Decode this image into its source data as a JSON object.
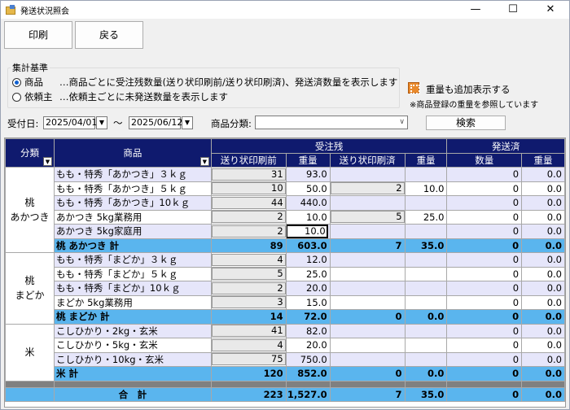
{
  "window": {
    "title": "発送状況照会",
    "minimize": "—",
    "maximize": "☐",
    "close": "✕"
  },
  "toolbar": {
    "print_label": "印刷",
    "back_label": "戻る"
  },
  "criteria": {
    "group_label": "集計基準",
    "opt_product": "商品",
    "opt_product_desc": "…商品ごとに受注残数量(送り状印刷前/送り状印刷済)、発送済数量を表示します",
    "opt_client": "依頼主",
    "opt_client_desc": "…依頼主ごとに未発送数量を表示します",
    "selected": "商品"
  },
  "weight": {
    "label": "重量も追加表示する",
    "note": "※商品登録の重量を参照しています"
  },
  "filter": {
    "date_label": "受付日:",
    "date_from": "2025/04/01",
    "tilde": "〜",
    "date_to": "2025/06/12",
    "category_label": "商品分類:",
    "category_value": "",
    "search_label": "検索"
  },
  "grid": {
    "headers": {
      "category": "分類",
      "product": "商品",
      "backlog": "受注残",
      "shipped": "発送済",
      "before_print": "送り状印刷前",
      "weight": "重量",
      "after_print": "送り状印刷済",
      "qty": "数量"
    },
    "groups": [
      {
        "category": "桃\nあかつき",
        "rows": [
          {
            "name": "もも・特秀「あかつき」３ｋｇ",
            "bp": "31",
            "bpw": "93.0",
            "ap": "",
            "apw": "",
            "sq": "0",
            "sw": "0.0"
          },
          {
            "name": "もも・特秀「あかつき」５ｋｇ",
            "bp": "10",
            "bpw": "50.0",
            "ap": "2",
            "apw": "10.0",
            "sq": "0",
            "sw": "0.0"
          },
          {
            "name": "もも・特秀「あかつき」10ｋｇ",
            "bp": "44",
            "bpw": "440.0",
            "ap": "",
            "apw": "",
            "sq": "0",
            "sw": "0.0"
          },
          {
            "name": "あかつき 5kg業務用",
            "bp": "2",
            "bpw": "10.0",
            "ap": "5",
            "apw": "25.0",
            "sq": "0",
            "sw": "0.0"
          },
          {
            "name": "あかつき 5kg家庭用",
            "bp": "2",
            "bpw": "10.0",
            "ap": "",
            "apw": "",
            "sq": "0",
            "sw": "0.0"
          }
        ],
        "subtotal": {
          "name": "桃 あかつき 計",
          "bp": "89",
          "bpw": "603.0",
          "ap": "7",
          "apw": "35.0",
          "sq": "0",
          "sw": "0.0"
        }
      },
      {
        "category": "桃\nまどか",
        "rows": [
          {
            "name": "もも・特秀「まどか」３ｋｇ",
            "bp": "4",
            "bpw": "12.0",
            "ap": "",
            "apw": "",
            "sq": "0",
            "sw": "0.0"
          },
          {
            "name": "もも・特秀「まどか」５ｋｇ",
            "bp": "5",
            "bpw": "25.0",
            "ap": "",
            "apw": "",
            "sq": "0",
            "sw": "0.0"
          },
          {
            "name": "もも・特秀「まどか」10ｋｇ",
            "bp": "2",
            "bpw": "20.0",
            "ap": "",
            "apw": "",
            "sq": "0",
            "sw": "0.0"
          },
          {
            "name": "まどか 5kg業務用",
            "bp": "3",
            "bpw": "15.0",
            "ap": "",
            "apw": "",
            "sq": "0",
            "sw": "0.0"
          }
        ],
        "subtotal": {
          "name": "桃 まどか 計",
          "bp": "14",
          "bpw": "72.0",
          "ap": "0",
          "apw": "0.0",
          "sq": "0",
          "sw": "0.0"
        }
      },
      {
        "category": "米",
        "rows": [
          {
            "name": "こしひかり・2kg・玄米",
            "bp": "41",
            "bpw": "82.0",
            "ap": "",
            "apw": "",
            "sq": "0",
            "sw": "0.0"
          },
          {
            "name": "こしひかり・5kg・玄米",
            "bp": "4",
            "bpw": "20.0",
            "ap": "",
            "apw": "",
            "sq": "0",
            "sw": "0.0"
          },
          {
            "name": "こしひかり・10kg・玄米",
            "bp": "75",
            "bpw": "750.0",
            "ap": "",
            "apw": "",
            "sq": "0",
            "sw": "0.0"
          }
        ],
        "subtotal": {
          "name": "米 計",
          "bp": "120",
          "bpw": "852.0",
          "ap": "0",
          "apw": "0.0",
          "sq": "0",
          "sw": "0.0"
        }
      }
    ],
    "total": {
      "name": "合　計",
      "bp": "223",
      "bpw": "1,527.0",
      "ap": "7",
      "apw": "35.0",
      "sq": "0",
      "sw": "0.0"
    }
  }
}
